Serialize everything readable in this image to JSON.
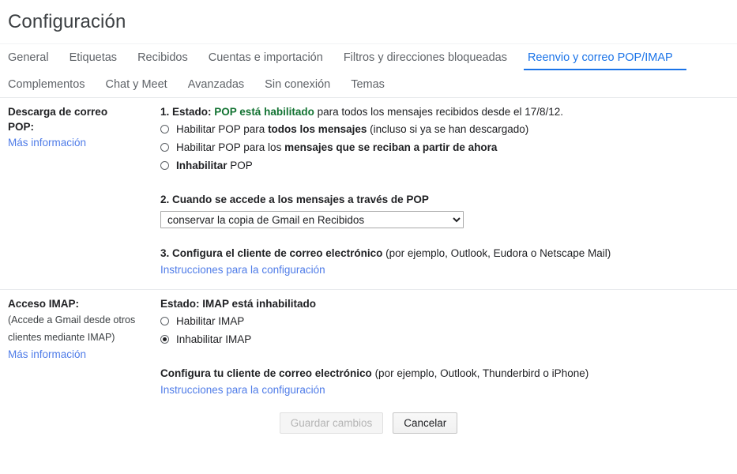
{
  "header": {
    "title": "Configuración"
  },
  "tabs": {
    "row1": [
      {
        "label": "General",
        "active": false
      },
      {
        "label": "Etiquetas",
        "active": false
      },
      {
        "label": "Recibidos",
        "active": false
      },
      {
        "label": "Cuentas e importación",
        "active": false
      },
      {
        "label": "Filtros y direcciones bloqueadas",
        "active": false
      },
      {
        "label": "Reenvio y correo POP/IMAP",
        "active": true
      }
    ],
    "row2": [
      {
        "label": "Complementos",
        "active": false
      },
      {
        "label": "Chat y Meet",
        "active": false
      },
      {
        "label": "Avanzadas",
        "active": false
      },
      {
        "label": "Sin conexión",
        "active": false
      },
      {
        "label": "Temas",
        "active": false
      }
    ]
  },
  "pop": {
    "left_title_line1": "Descarga de correo",
    "left_title_line2": "POP:",
    "more_info": "Más información",
    "status_prefix": "1. Estado:",
    "status_highlight": "POP está habilitado",
    "status_suffix": "para todos los mensajes recibidos desde el 17/8/12.",
    "options": [
      {
        "pre": "Habilitar POP para ",
        "strong": "todos los mensajes",
        "post": " (incluso si ya se han descargado)",
        "checked": false
      },
      {
        "pre": "Habilitar POP para los ",
        "strong": "mensajes que se reciban a partir de ahora",
        "post": "",
        "checked": false
      },
      {
        "pre": "",
        "strong": "Inhabilitar",
        "post": " POP",
        "checked": false
      }
    ],
    "step2_label": "2. Cuando se accede a los mensajes a través de POP",
    "step2_selected": "conservar la copia de Gmail en Recibidos",
    "step2_options": [
      "conservar la copia de Gmail en Recibidos"
    ],
    "step3_bold": "3. Configura el cliente de correo electrónico",
    "step3_normal": " (por ejemplo, Outlook, Eudora o Netscape Mail)",
    "step3_link": "Instrucciones para la configuración"
  },
  "imap": {
    "left_title": "Acceso IMAP:",
    "left_note_line1": "(Accede a Gmail desde otros",
    "left_note_line2": "clientes mediante IMAP)",
    "more_info": "Más información",
    "status": "Estado: IMAP está inhabilitado",
    "options": [
      {
        "label": "Habilitar IMAP",
        "checked": false
      },
      {
        "label": "Inhabilitar IMAP",
        "checked": true
      }
    ],
    "config_bold": "Configura tu cliente de correo electrónico",
    "config_normal": " (por ejemplo, Outlook, Thunderbird o iPhone)",
    "config_link": "Instrucciones para la configuración"
  },
  "footer": {
    "save_label": "Guardar cambios",
    "cancel_label": "Cancelar"
  },
  "colors": {
    "accent": "#1a73e8",
    "link": "#4f7ce8",
    "status_green": "#137333",
    "text": "#202124",
    "muted": "#5f6368",
    "divider": "#e8eaed"
  }
}
